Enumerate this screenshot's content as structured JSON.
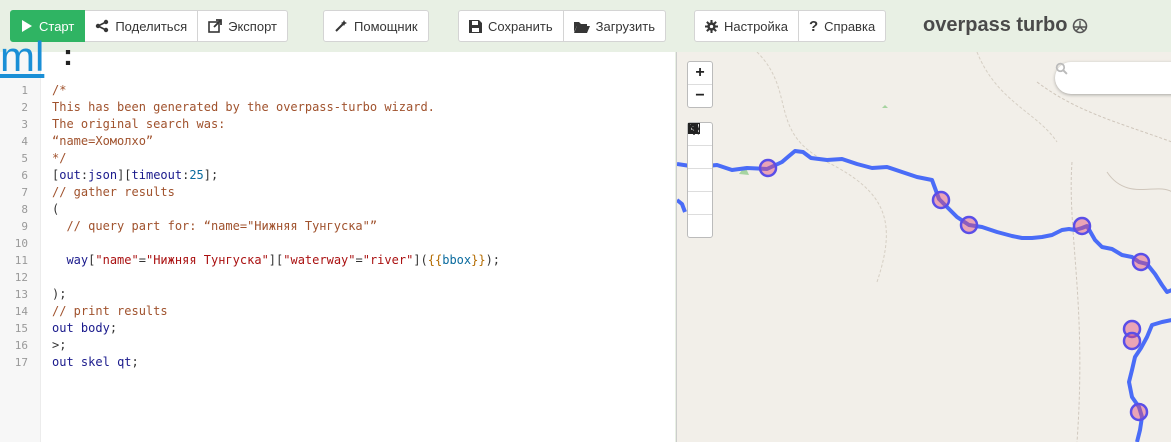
{
  "toolbar": {
    "run_label": "Старт",
    "share_label": "Поделиться",
    "export_label": "Экспорт",
    "wizard_label": "Помощник",
    "save_label": "Сохранить",
    "load_label": "Загрузить",
    "settings_label": "Настройка",
    "help_label": "Справка"
  },
  "brand": {
    "title": "overpass turbo"
  },
  "logo_fragment": "ml",
  "editor": {
    "lines": [
      {
        "n": "1",
        "text": "/*"
      },
      {
        "n": "2",
        "text": "This has been generated by the overpass-turbo wizard."
      },
      {
        "n": "3",
        "text": "The original search was:"
      },
      {
        "n": "4",
        "text": "“name=Хомолхо”"
      },
      {
        "n": "5",
        "text": "*/"
      },
      {
        "n": "6",
        "text": "[out:json][timeout:25];"
      },
      {
        "n": "7",
        "text": "// gather results"
      },
      {
        "n": "8",
        "text": "("
      },
      {
        "n": "9",
        "text": "  // query part for: “name=\"Нижняя Тунгуска\"”"
      },
      {
        "n": "10",
        "text": ""
      },
      {
        "n": "11",
        "text": "  way[\"name\"=\"Нижняя Тунгуска\"][\"waterway\"=\"river\"]({{bbox}});"
      },
      {
        "n": "12",
        "text": ""
      },
      {
        "n": "13",
        "text": ");"
      },
      {
        "n": "14",
        "text": "// print results"
      },
      {
        "n": "15",
        "text": "out body;"
      },
      {
        "n": "16",
        "text": ">;"
      },
      {
        "n": "17",
        "text": "out skel qt;"
      }
    ]
  },
  "map": {
    "zoom_in": "+",
    "zoom_out": "−",
    "river_color": "#4a6cf7",
    "marker_color": "#e04a78"
  }
}
